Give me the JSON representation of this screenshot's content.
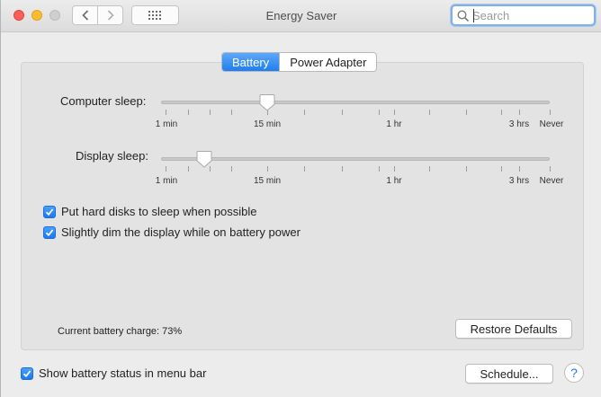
{
  "window": {
    "title": "Energy Saver"
  },
  "search": {
    "placeholder": "Search",
    "value": ""
  },
  "tabs": [
    {
      "label": "Battery",
      "active": true
    },
    {
      "label": "Power Adapter",
      "active": false
    }
  ],
  "sliders": [
    {
      "label": "Computer sleep:",
      "tick_labels": [
        "1 min",
        "15 min",
        "1 hr",
        "3 hrs",
        "Never"
      ],
      "value": "15 min"
    },
    {
      "label": "Display sleep:",
      "tick_labels": [
        "1 min",
        "15 min",
        "1 hr",
        "3 hrs",
        "Never"
      ],
      "value_fraction": 0.1
    }
  ],
  "checkboxes": [
    {
      "label": "Put hard disks to sleep when possible",
      "checked": true
    },
    {
      "label": "Slightly dim the display while on battery power",
      "checked": true
    }
  ],
  "battery_charge": "Current battery charge: 73%",
  "buttons": {
    "restore_defaults": "Restore Defaults",
    "schedule": "Schedule...",
    "help": "?"
  },
  "footer": {
    "show_status": {
      "label": "Show battery status in menu bar",
      "checked": true
    }
  },
  "colors": {
    "accent": "#1f7ef0",
    "close": "#fc5f57",
    "minimize": "#fdbc2e",
    "zoom": "#cfcfcf"
  },
  "icons": [
    "close-icon",
    "minimize-icon",
    "zoom-icon",
    "chevron-left-icon",
    "chevron-right-icon",
    "grid-icon",
    "search-icon",
    "checkmark-icon",
    "help-icon"
  ]
}
